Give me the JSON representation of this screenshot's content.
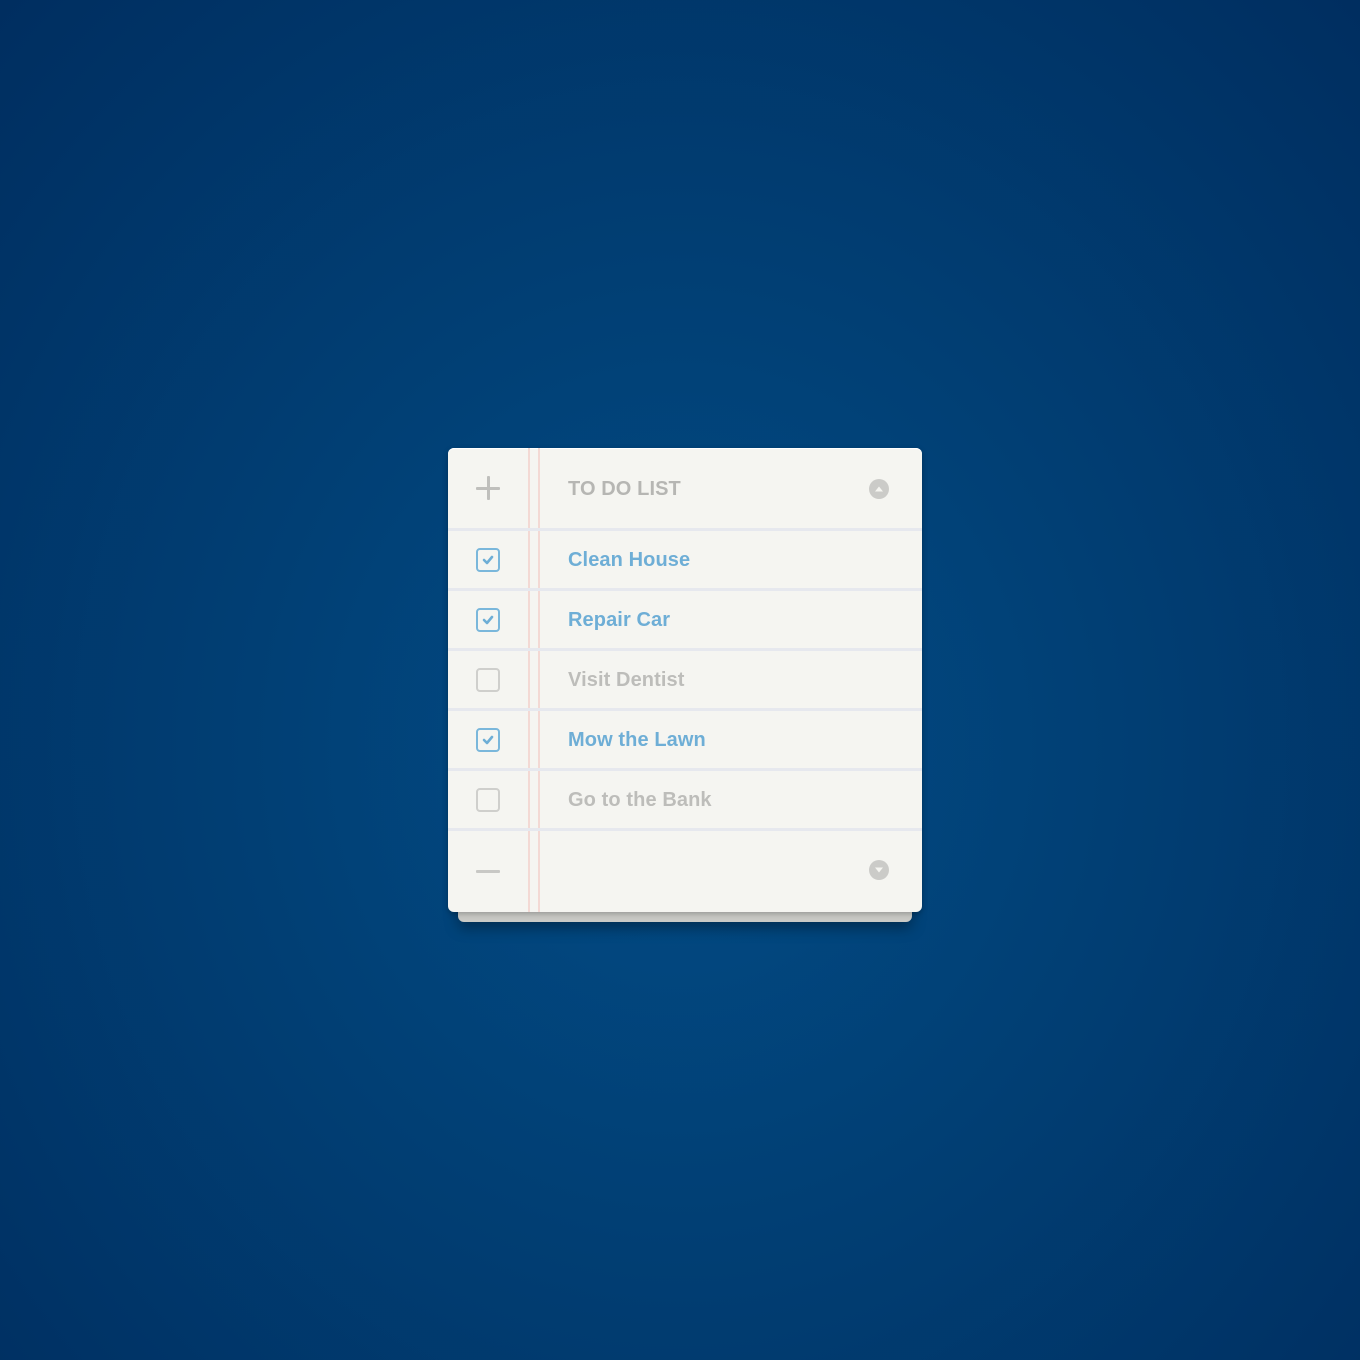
{
  "widget": {
    "title": "TO DO LIST",
    "add_icon": "plus-icon",
    "remove_icon": "minus-icon",
    "scroll_up_icon": "chevron-up-icon",
    "scroll_down_icon": "chevron-down-icon"
  },
  "items": [
    {
      "label": "Clean House",
      "checked": true
    },
    {
      "label": "Repair Car",
      "checked": true
    },
    {
      "label": "Visit Dentist",
      "checked": false
    },
    {
      "label": "Mow the Lawn",
      "checked": true
    },
    {
      "label": "Go to the Bank",
      "checked": false
    }
  ],
  "colors": {
    "background": "#013f74",
    "paper": "#f5f5f1",
    "checked_text": "#6eaed6",
    "unchecked_text": "#bdbdba",
    "margin_line": "#f3d9d4",
    "row_divider": "#e6e8ee"
  }
}
